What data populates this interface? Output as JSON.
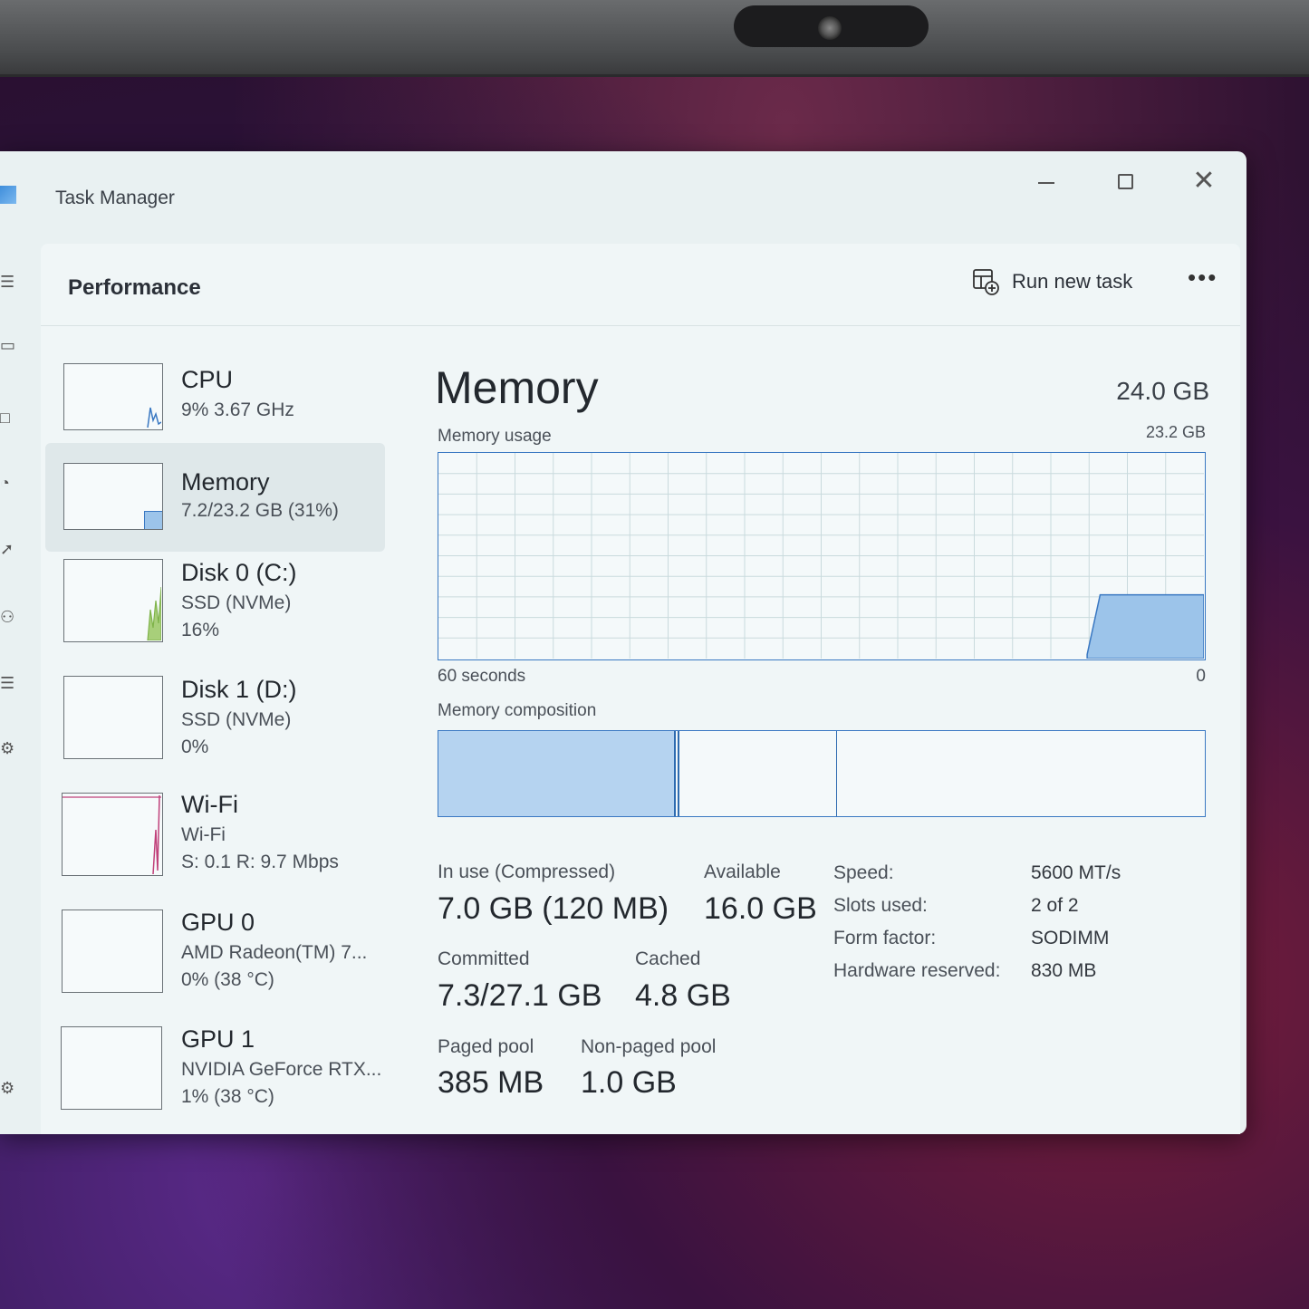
{
  "window": {
    "title": "Task Manager"
  },
  "header": {
    "page_title": "Performance",
    "run_new_task_label": "Run new task",
    "more_label": "•••"
  },
  "sidebar": {
    "items": [
      {
        "name": "CPU",
        "line1": "9%  3.67 GHz",
        "line2": ""
      },
      {
        "name": "Memory",
        "line1": "7.2/23.2 GB (31%)",
        "line2": ""
      },
      {
        "name": "Disk 0 (C:)",
        "line1": "SSD (NVMe)",
        "line2": "16%"
      },
      {
        "name": "Disk 1 (D:)",
        "line1": "SSD (NVMe)",
        "line2": "0%"
      },
      {
        "name": "Wi-Fi",
        "line1": "Wi-Fi",
        "line2": "S: 0.1  R: 9.7 Mbps"
      },
      {
        "name": "GPU 0",
        "line1": "AMD Radeon(TM) 7...",
        "line2": "0%  (38 °C)"
      },
      {
        "name": "GPU 1",
        "line1": "NVIDIA GeForce RTX...",
        "line2": "1%  (38 °C)"
      }
    ]
  },
  "memory": {
    "heading": "Memory",
    "total": "24.0 GB",
    "usage_label": "Memory usage",
    "usage_max": "23.2 GB",
    "time_left": "60 seconds",
    "time_right": "0",
    "composition_label": "Memory composition",
    "composition": {
      "in_use_fraction": 0.31,
      "modified_fraction": 0.01,
      "standby_fraction": 0.2
    },
    "usage_history_fraction": [
      0,
      0,
      0,
      0,
      0,
      0,
      0,
      0,
      0,
      0,
      0,
      0,
      0,
      0,
      0,
      0,
      0,
      0,
      0,
      0,
      0,
      0,
      0,
      0,
      0,
      0,
      0,
      0,
      0,
      0,
      0,
      0,
      0,
      0,
      0,
      0,
      0,
      0,
      0,
      0,
      0,
      0,
      0,
      0,
      0,
      0,
      0,
      0,
      0,
      0,
      0.02,
      0.31,
      0.31,
      0.31,
      0.31,
      0.31,
      0.31,
      0.31,
      0.31,
      0.31
    ],
    "stats": {
      "in_use_label": "In use (Compressed)",
      "in_use_value": "7.0 GB (120 MB)",
      "available_label": "Available",
      "available_value": "16.0 GB",
      "committed_label": "Committed",
      "committed_value": "7.3/27.1 GB",
      "cached_label": "Cached",
      "cached_value": "4.8 GB",
      "paged_label": "Paged pool",
      "paged_value": "385 MB",
      "nonpaged_label": "Non-paged pool",
      "nonpaged_value": "1.0 GB"
    },
    "properties": {
      "speed_label": "Speed:",
      "speed_value": "5600 MT/s",
      "slots_label": "Slots used:",
      "slots_value": "2 of 2",
      "form_label": "Form factor:",
      "form_value": "SODIMM",
      "reserved_label": "Hardware reserved:",
      "reserved_value": "830 MB"
    }
  },
  "colors": {
    "accent": "#3a78c2",
    "memory_fill": "#9cc4ea",
    "cpu_line": "#3a78c2",
    "disk_fill": "#7fb34a",
    "wifi_line": "#c0407a"
  }
}
